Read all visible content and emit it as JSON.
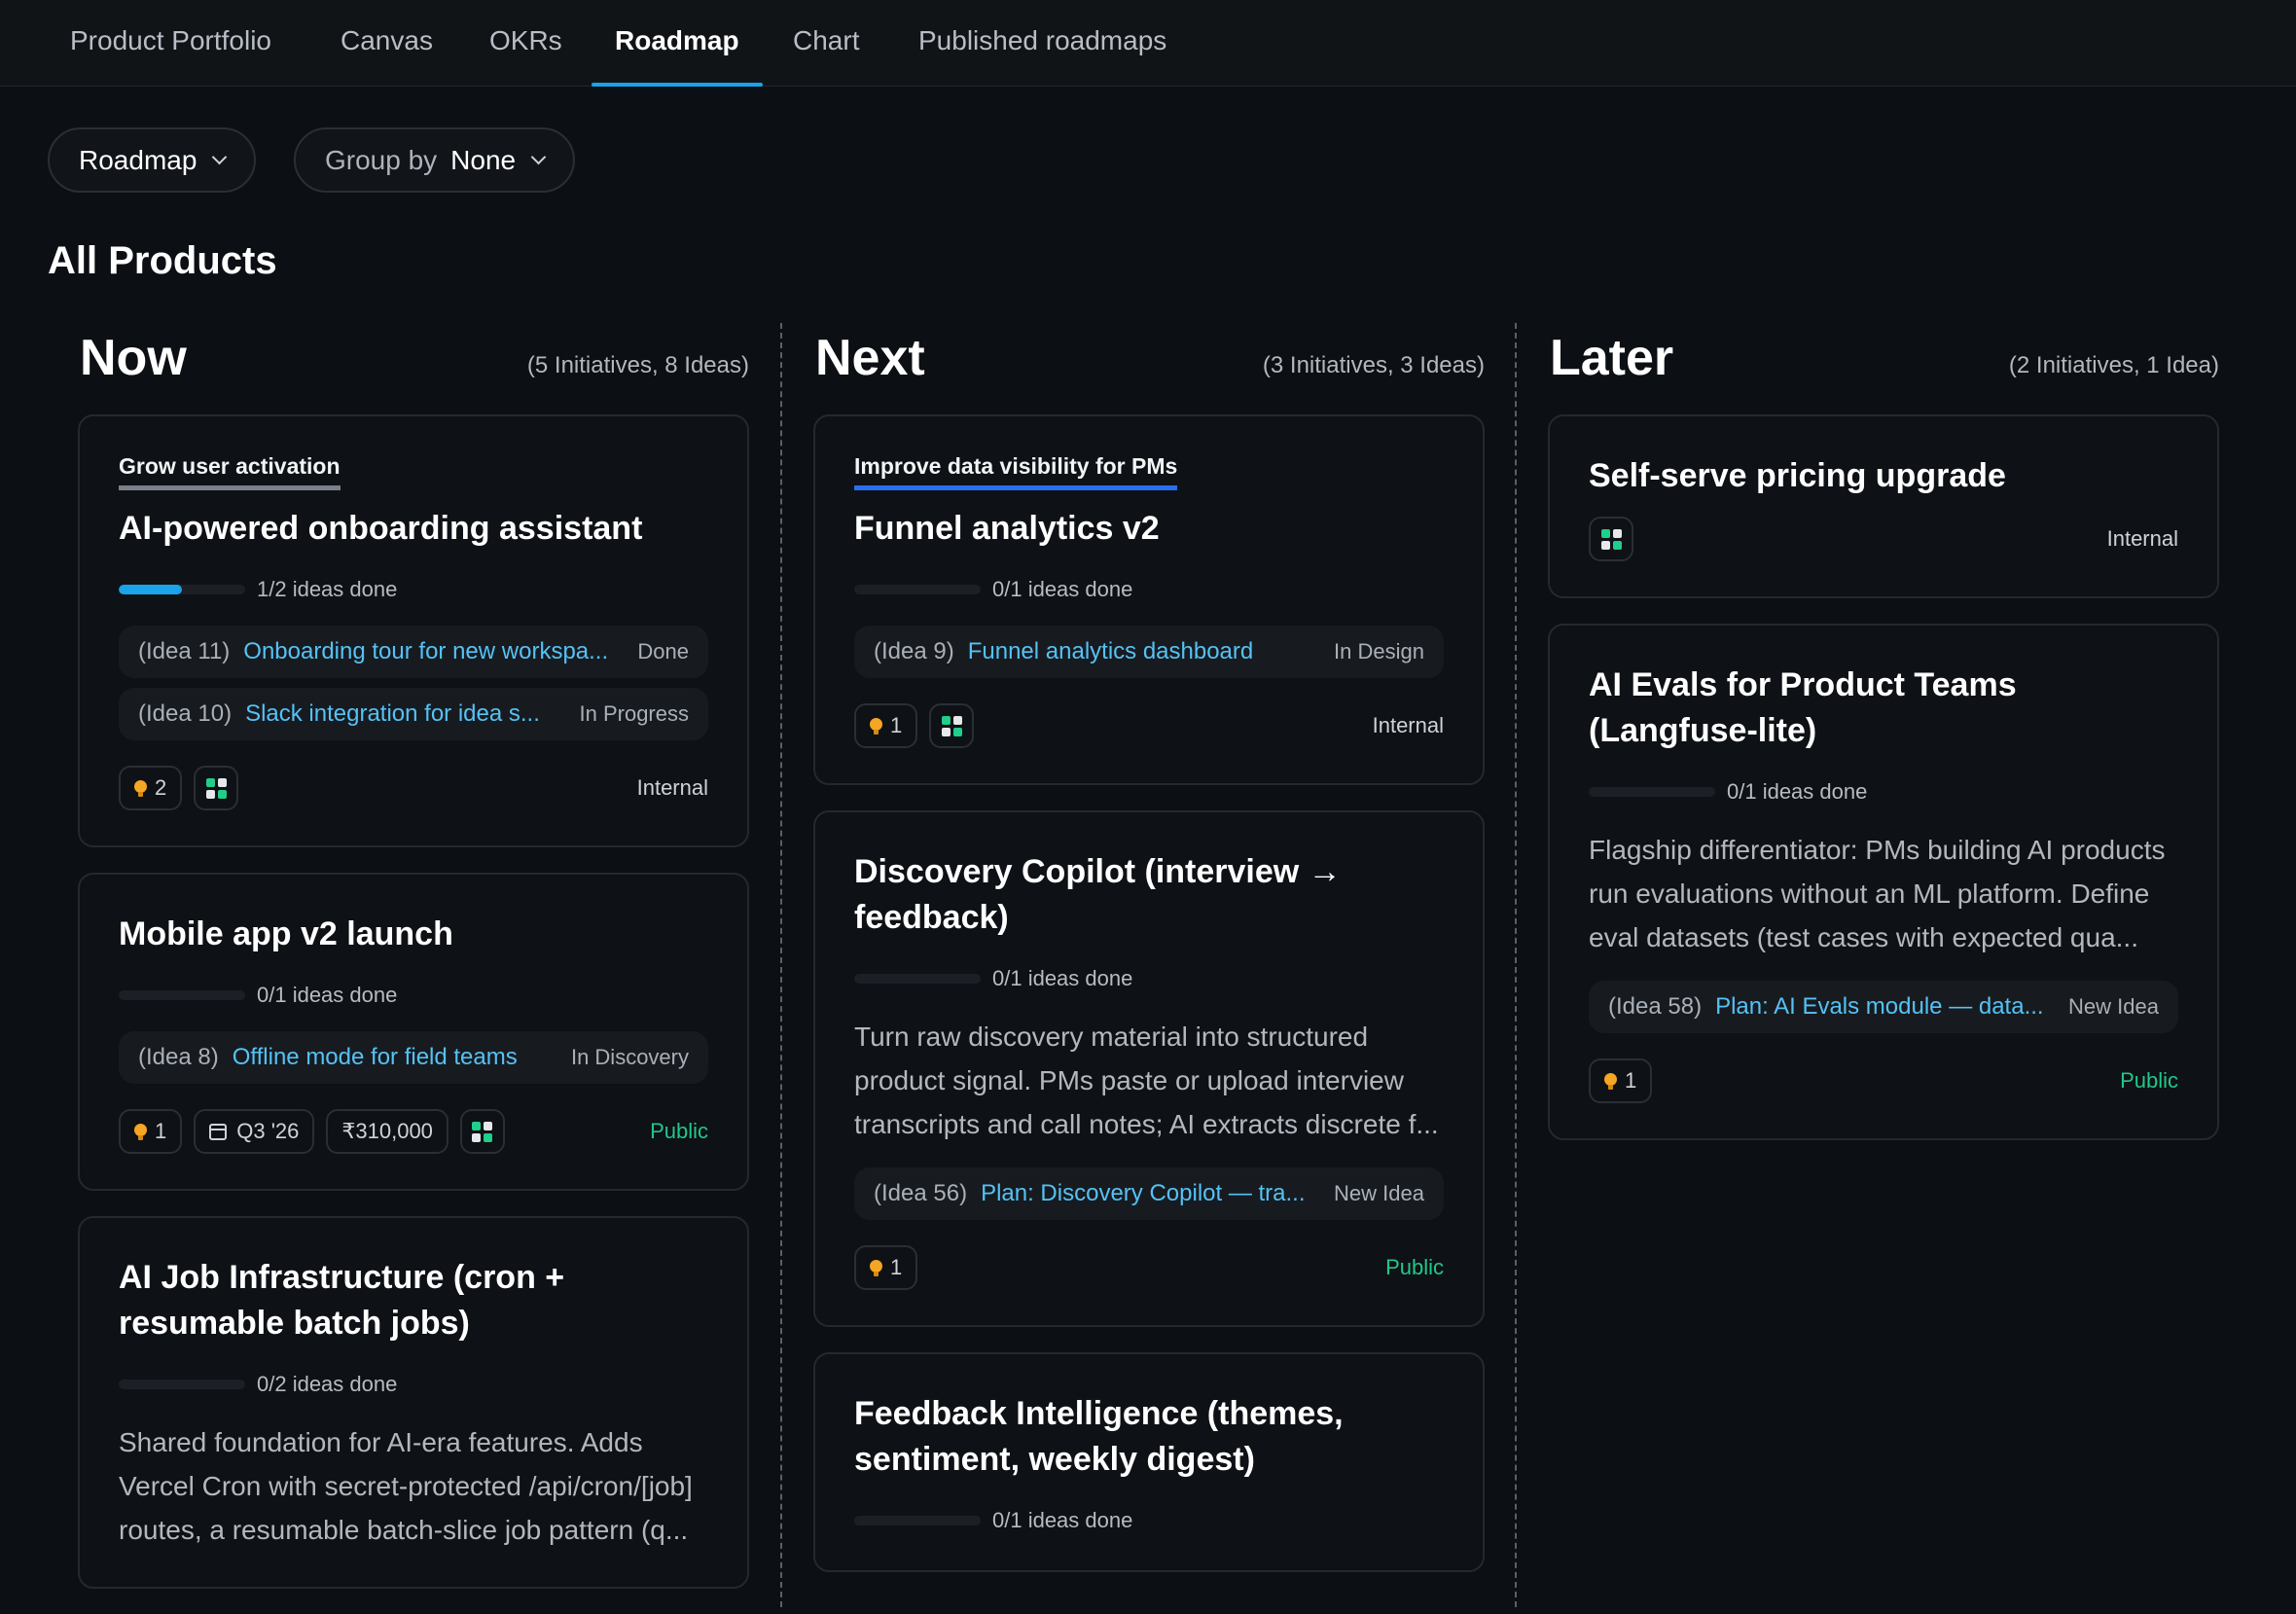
{
  "nav": {
    "tabs": [
      "Product Portfolio",
      "Canvas",
      "OKRs",
      "Roadmap",
      "Chart",
      "Published roadmaps"
    ],
    "active_index": 3
  },
  "filters": {
    "view_label": "Roadmap",
    "group_by_label": "Group by",
    "group_by_value": "None"
  },
  "section_title": "All Products",
  "colors": {
    "accent": "#1aa3e8",
    "link": "#55c2f5",
    "public": "#22c78a",
    "goal_blue": "#2a6ef0",
    "goal_gray": "#7a8089"
  },
  "columns": {
    "now": {
      "title": "Now",
      "count": "(5 Initiatives, 8 Ideas)",
      "cards": [
        {
          "goal": "Grow user activation",
          "title": "AI-powered onboarding assistant",
          "progress_text": "1/2 ideas done",
          "progress": 0.5,
          "ideas": [
            {
              "num": "(Idea 11)",
              "title": "Onboarding tour for new workspa...",
              "status": "Done"
            },
            {
              "num": "(Idea 10)",
              "title": "Slack integration for idea s...",
              "status": "In Progress"
            }
          ],
          "idea_count": "2",
          "visibility": "Internal"
        },
        {
          "title": "Mobile app v2 launch",
          "progress_text": "0/1 ideas done",
          "progress": 0,
          "ideas": [
            {
              "num": "(Idea 8)",
              "title": "Offline mode for field teams",
              "status": "In Discovery"
            }
          ],
          "idea_count": "1",
          "date": "Q3 '26",
          "budget": "₹310,000",
          "visibility": "Public"
        },
        {
          "title": "AI Job Infrastructure (cron + resumable batch jobs)",
          "progress_text": "0/2 ideas done",
          "progress": 0,
          "description": "Shared foundation for AI-era features. Adds Vercel Cron with secret-protected /api/cron/[job] routes, a resumable batch-slice job pattern (q..."
        }
      ]
    },
    "next": {
      "title": "Next",
      "count": "(3 Initiatives, 3 Ideas)",
      "cards": [
        {
          "goal": "Improve data visibility for PMs",
          "title": "Funnel analytics v2",
          "progress_text": "0/1 ideas done",
          "progress": 0,
          "ideas": [
            {
              "num": "(Idea 9)",
              "title": "Funnel analytics dashboard",
              "status": "In Design"
            }
          ],
          "idea_count": "1",
          "visibility": "Internal"
        },
        {
          "title": "Discovery Copilot (interview → feedback)",
          "progress_text": "0/1 ideas done",
          "progress": 0,
          "description": "Turn raw discovery material into structured product signal. PMs paste or upload interview transcripts and call notes; AI extracts discrete f...",
          "ideas": [
            {
              "num": "(Idea 56)",
              "title": "Plan: Discovery Copilot — tra...",
              "status": "New Idea"
            }
          ],
          "idea_count": "1",
          "visibility": "Public"
        },
        {
          "title": "Feedback Intelligence (themes, sentiment, weekly digest)",
          "progress_text": "0/1 ideas done",
          "progress": 0
        }
      ]
    },
    "later": {
      "title": "Later",
      "count": "(2 Initiatives, 1 Idea)",
      "cards": [
        {
          "title": "Self-serve pricing upgrade",
          "visibility": "Internal"
        },
        {
          "title": "AI Evals for Product Teams (Langfuse-lite)",
          "progress_text": "0/1 ideas done",
          "progress": 0,
          "description": "Flagship differentiator: PMs building AI products run evaluations without an ML platform. Define eval datasets (test cases with expected qua...",
          "ideas": [
            {
              "num": "(Idea 58)",
              "title": "Plan: AI Evals module — data...",
              "status": "New Idea"
            }
          ],
          "idea_count": "1",
          "visibility": "Public"
        }
      ]
    }
  }
}
